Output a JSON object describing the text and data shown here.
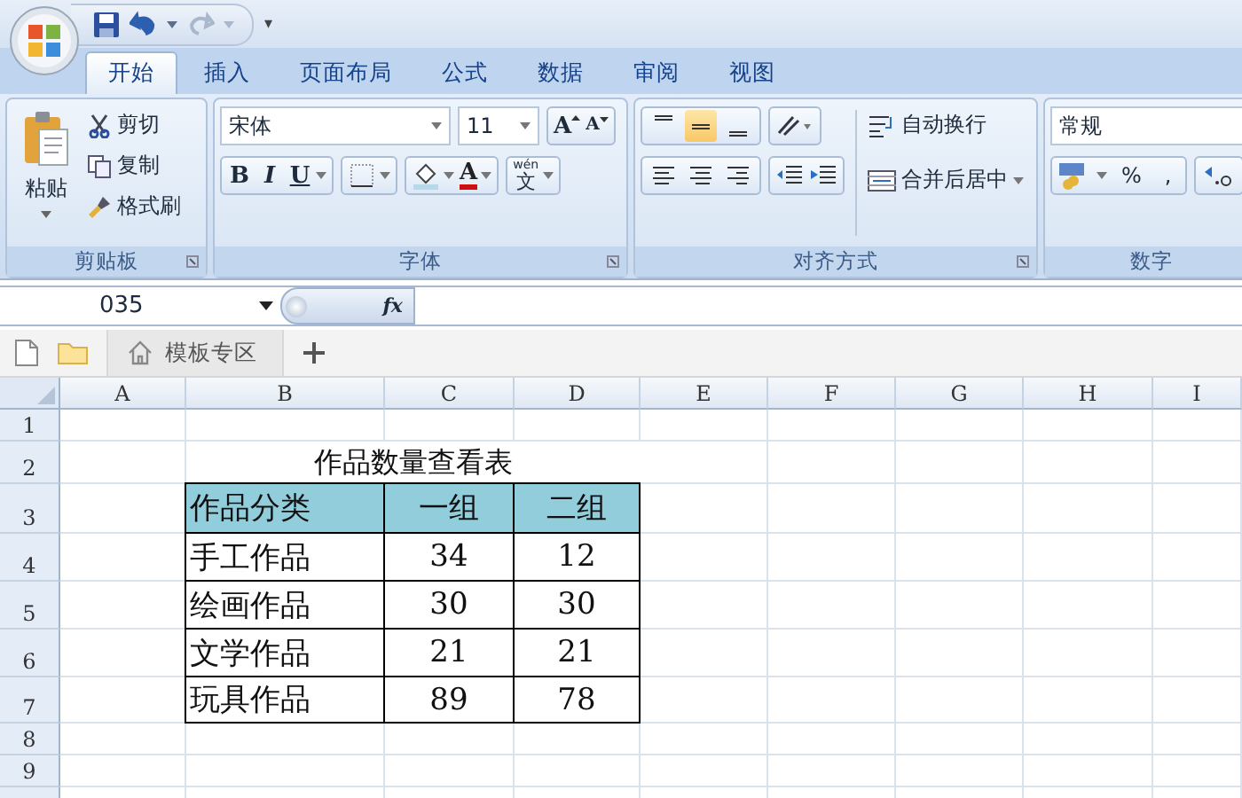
{
  "quick_access": {
    "customize": "▾"
  },
  "tabs": [
    {
      "label": "开始",
      "selected": true
    },
    {
      "label": "插入",
      "selected": false
    },
    {
      "label": "页面布局",
      "selected": false
    },
    {
      "label": "公式",
      "selected": false
    },
    {
      "label": "数据",
      "selected": false
    },
    {
      "label": "审阅",
      "selected": false
    },
    {
      "label": "视图",
      "selected": false
    }
  ],
  "clipboard": {
    "paste": "粘贴",
    "actions": [
      {
        "kind": "cut",
        "label": "剪切"
      },
      {
        "kind": "copy",
        "label": "复制"
      },
      {
        "kind": "brush",
        "label": "格式刷"
      }
    ],
    "group_label": "剪贴板"
  },
  "font": {
    "name": "宋体",
    "size": "11",
    "grow": "A",
    "shrink": "A",
    "styles": [
      "B",
      "I",
      "U"
    ],
    "color_letter": "A",
    "phonetic": {
      "pinyin": "wén",
      "char": "文"
    },
    "group_label": "字体"
  },
  "alignment": {
    "vertical": [
      {
        "kind": "top",
        "selected": false
      },
      {
        "kind": "middle",
        "selected": true
      },
      {
        "kind": "bottom",
        "selected": false
      }
    ],
    "horizontal": [
      {
        "kind": "left",
        "selected": false
      },
      {
        "kind": "center",
        "selected": false
      },
      {
        "kind": "right",
        "selected": false
      }
    ],
    "wrap": "自动换行",
    "merge": "合并后居中",
    "group_label": "对齐方式"
  },
  "number": {
    "format": "常规",
    "percent": "%",
    "comma": ",",
    "group_label": "数字"
  },
  "name_box": "035",
  "fx": "fx",
  "sheet_tabs": [
    {
      "label": "模板专区"
    }
  ],
  "columns": [
    "A",
    "B",
    "C",
    "D",
    "E",
    "F",
    "G",
    "H",
    "I"
  ],
  "rows": [
    "1",
    "2",
    "3",
    "4",
    "5",
    "6",
    "7",
    "8",
    "9"
  ],
  "title": "作品数量查看表",
  "table": {
    "header": [
      "作品分类",
      "一组",
      "二组"
    ],
    "rows": [
      [
        "手工作品",
        "34",
        "12"
      ],
      [
        "绘画作品",
        "30",
        "30"
      ],
      [
        "文学作品",
        "21",
        "21"
      ],
      [
        "玩具作品",
        "89",
        "78"
      ]
    ]
  }
}
